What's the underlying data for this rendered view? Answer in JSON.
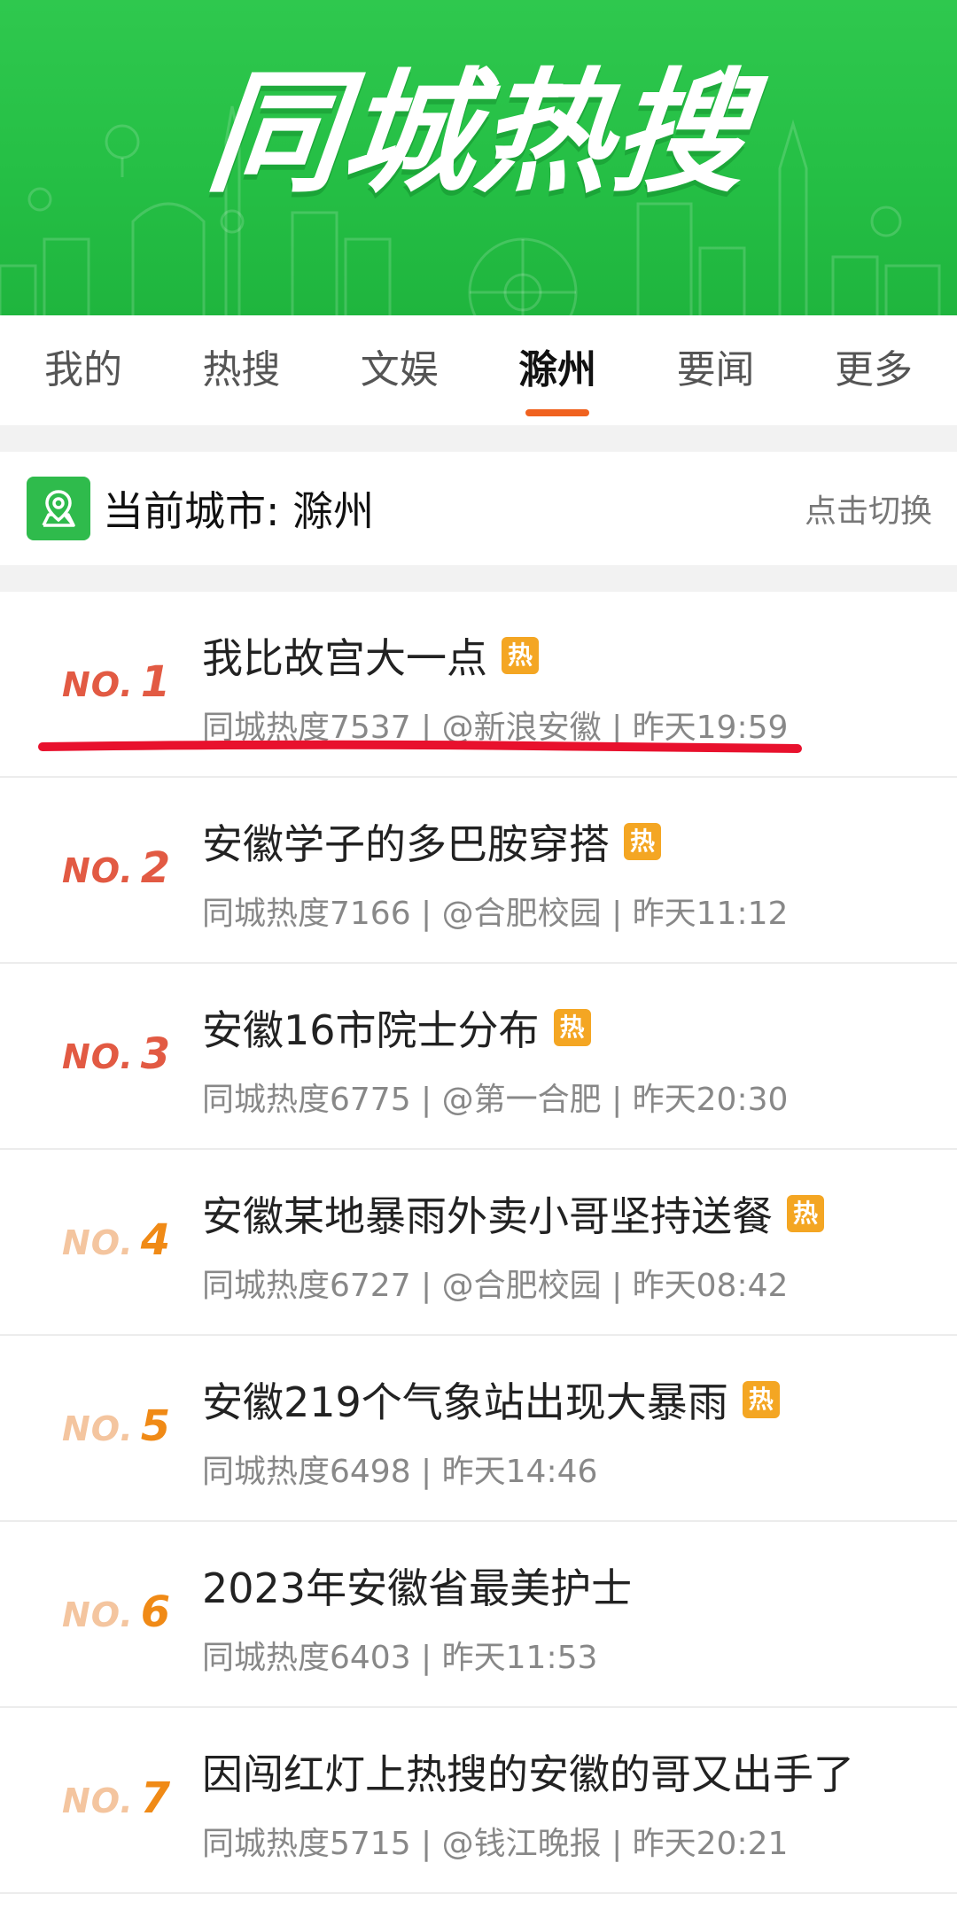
{
  "banner": {
    "title": "同城热搜"
  },
  "tabs": [
    {
      "label": "我的",
      "active": false
    },
    {
      "label": "热搜",
      "active": false
    },
    {
      "label": "文娱",
      "active": false
    },
    {
      "label": "滁州",
      "active": true
    },
    {
      "label": "要闻",
      "active": false
    },
    {
      "label": "更多",
      "active": false
    }
  ],
  "city_bar": {
    "icon": "location-map-icon",
    "text": "当前城市: 滁州",
    "switch_label": "点击切换"
  },
  "list": [
    {
      "rank_prefix": "NO.",
      "rank": "1",
      "title": "我比故宫大一点",
      "hot": "热",
      "meta": "同城热度7537 | @新浪安徽 | 昨天19:59"
    },
    {
      "rank_prefix": "NO.",
      "rank": "2",
      "title": "安徽学子的多巴胺穿搭",
      "hot": "热",
      "meta": "同城热度7166 | @合肥校园 | 昨天11:12"
    },
    {
      "rank_prefix": "NO.",
      "rank": "3",
      "title": "安徽16市院士分布",
      "hot": "热",
      "meta": "同城热度6775 | @第一合肥 | 昨天20:30"
    },
    {
      "rank_prefix": "NO.",
      "rank": "4",
      "title": "安徽某地暴雨外卖小哥坚持送餐",
      "hot": "热",
      "meta": "同城热度6727 | @合肥校园 | 昨天08:42"
    },
    {
      "rank_prefix": "NO.",
      "rank": "5",
      "title": "安徽219个气象站出现大暴雨",
      "hot": "热",
      "meta": "同城热度6498 | 昨天14:46"
    },
    {
      "rank_prefix": "NO.",
      "rank": "6",
      "title": "2023年安徽省最美护士",
      "hot": "",
      "meta": "同城热度6403 | 昨天11:53"
    },
    {
      "rank_prefix": "NO.",
      "rank": "7",
      "title": "因闯红灯上热搜的安徽的哥又出手了",
      "hot": "",
      "meta": "同城热度5715 | @钱江晚报 | 昨天20:21"
    }
  ],
  "colors": {
    "banner_green": "#27c147",
    "tab_underline": "#f0621f",
    "rank_red": "#e25a43",
    "rank_orange": "#f08a16",
    "hot_badge": "#f4a623",
    "annotation_red": "#e8112d"
  }
}
